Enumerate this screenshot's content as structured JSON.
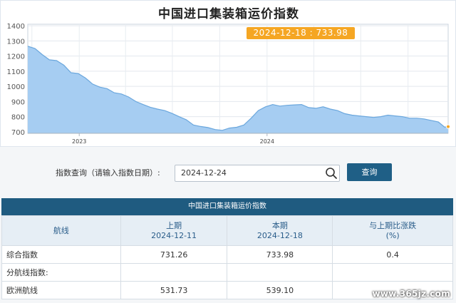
{
  "chart_data": {
    "type": "area",
    "title": "中国进口集装箱运价指数",
    "ylim": [
      690,
      1410
    ],
    "y_ticks": [
      1400,
      1300,
      1200,
      1100,
      1000,
      900,
      800,
      700
    ],
    "x_tick_labels": [
      "2023",
      "2024"
    ],
    "x": [
      "2022-09-23",
      "2022-10-07",
      "2022-10-21",
      "2022-11-04",
      "2022-11-18",
      "2022-12-02",
      "2022-12-16",
      "2022-12-30",
      "2023-01-13",
      "2023-01-27",
      "2023-02-10",
      "2023-02-24",
      "2023-03-10",
      "2023-03-24",
      "2023-04-07",
      "2023-04-21",
      "2023-05-05",
      "2023-05-19",
      "2023-06-02",
      "2023-06-16",
      "2023-06-30",
      "2023-07-14",
      "2023-07-28",
      "2023-08-11",
      "2023-08-25",
      "2023-09-08",
      "2023-09-22",
      "2023-10-06",
      "2023-10-20",
      "2023-11-03",
      "2023-11-17",
      "2023-12-01",
      "2023-12-15",
      "2023-12-29",
      "2024-01-12",
      "2024-01-26",
      "2024-02-09",
      "2024-02-23",
      "2024-03-08",
      "2024-03-22",
      "2024-04-05",
      "2024-04-19",
      "2024-05-03",
      "2024-05-17",
      "2024-05-31",
      "2024-06-14",
      "2024-06-28",
      "2024-07-12",
      "2024-07-26",
      "2024-08-09",
      "2024-08-23",
      "2024-09-06",
      "2024-09-20",
      "2024-10-04",
      "2024-10-18",
      "2024-11-01",
      "2024-11-15",
      "2024-11-29",
      "2024-12-11",
      "2024-12-18"
    ],
    "series": [
      {
        "values": [
          1265,
          1250,
          1210,
          1175,
          1170,
          1140,
          1090,
          1085,
          1055,
          1015,
          995,
          985,
          958,
          950,
          930,
          900,
          880,
          862,
          850,
          840,
          822,
          800,
          780,
          745,
          735,
          728,
          715,
          710,
          725,
          730,
          745,
          790,
          840,
          865,
          880,
          870,
          875,
          878,
          880,
          860,
          855,
          865,
          850,
          840,
          820,
          810,
          805,
          800,
          795,
          800,
          810,
          805,
          800,
          790,
          790,
          785,
          775,
          765,
          731.26,
          733.98
        ]
      }
    ],
    "highlight": {
      "date": "2024-12-18",
      "value": 733.98
    },
    "colors": {
      "fill": "#a6cdf2",
      "stroke": "#6ba7dd"
    }
  },
  "chart": {
    "tooltip_text": "2024-12-18 : 733.98"
  },
  "query": {
    "label": "指数查询（请输入指数日期）:",
    "date_value": "2024-12-24",
    "button_label": "查询"
  },
  "table": {
    "title": "中国进口集装箱运价指数",
    "headers": {
      "route": "航线",
      "prev_period": "上期",
      "prev_date": "2024-12-11",
      "curr_period": "本期",
      "curr_date": "2024-12-18",
      "change": "与上期比涨跌",
      "change_unit": "(%)"
    },
    "rows": [
      {
        "route": "综合指数",
        "prev": "731.26",
        "curr": "733.98",
        "change": "0.4"
      },
      {
        "route": "分航线指数:",
        "prev": "",
        "curr": "",
        "change": ""
      },
      {
        "route": "欧洲航线",
        "prev": "531.73",
        "curr": "539.10",
        "change": ""
      }
    ]
  },
  "watermark": "www.365jz.com"
}
